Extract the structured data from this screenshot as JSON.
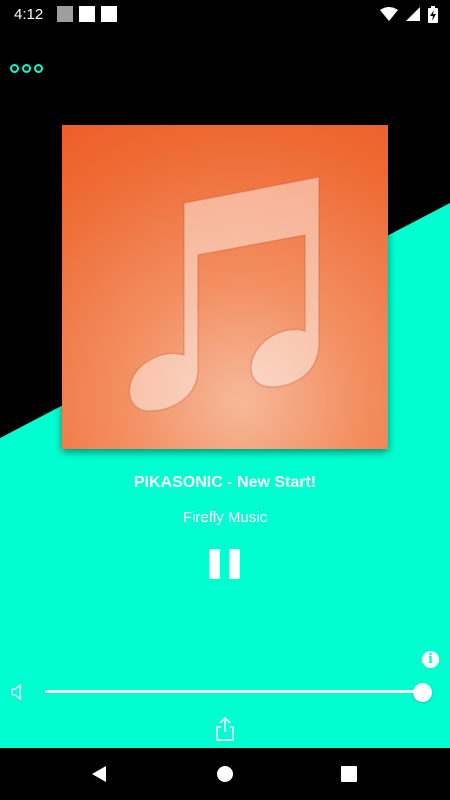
{
  "colors": {
    "accent": "#00ffd0",
    "album_orange": "#ee6a33",
    "background": "#000000"
  },
  "status_bar": {
    "time": "4:12",
    "icons": [
      "notification-icon",
      "notification-icon",
      "notification-icon",
      "wifi-icon",
      "signal-icon",
      "battery-charging-icon"
    ]
  },
  "header": {
    "menu_icon": "more-options-icon"
  },
  "player": {
    "album_icon": "music-note-icon",
    "title": "PIKASONIC - New Start!",
    "artist": "Firefly Music",
    "playback_state": "playing",
    "play_pause_icon": "pause-icon",
    "volume_level": 1.0
  },
  "controls": {
    "info_glyph": "i",
    "volume_icon": "volume-icon",
    "share_icon": "share-icon"
  },
  "nav": {
    "buttons": [
      "back-icon",
      "home-icon",
      "recents-icon"
    ]
  }
}
